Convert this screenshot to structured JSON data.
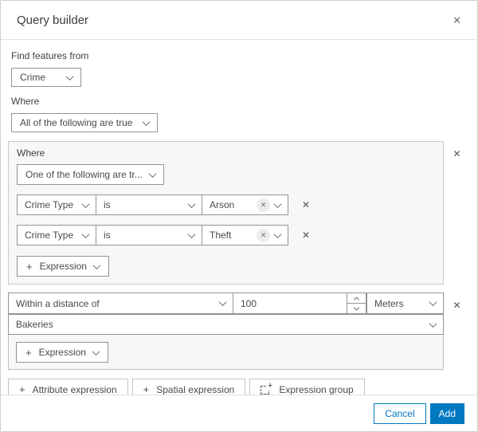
{
  "dialog": {
    "title": "Query builder"
  },
  "icons": {
    "close": "✕",
    "remove": "✕",
    "chip_clear": "✕",
    "plus": "+",
    "group_plus": "+"
  },
  "form": {
    "find_features_label": "Find features from",
    "layer_select": "Crime",
    "where_label": "Where",
    "logic_select": "All of the following are true"
  },
  "group": {
    "where_label": "Where",
    "logic_select": "One of the following are tr...",
    "rows": [
      {
        "field": "Crime Type",
        "operator": "is",
        "value": "Arson"
      },
      {
        "field": "Crime Type",
        "operator": "is",
        "value": "Theft"
      }
    ],
    "add_expression_label": "Expression"
  },
  "spatial": {
    "relation_select": "Within a distance of",
    "distance_value": "100",
    "unit_select": "Meters",
    "layer_select": "Bakeries",
    "add_expression_label": "Expression"
  },
  "actions": {
    "attribute_expression_label": "Attribute expression",
    "spatial_expression_label": "Spatial expression",
    "expression_group_label": "Expression group"
  },
  "footer": {
    "cancel_label": "Cancel",
    "add_label": "Add"
  },
  "colors": {
    "accent": "#0079c1",
    "group_background": "#f7f7f7",
    "input_border": "#949494"
  }
}
